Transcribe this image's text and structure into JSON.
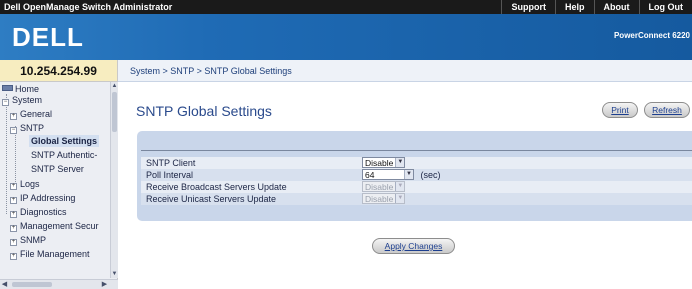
{
  "app": {
    "title": "Dell OpenManage Switch Administrator",
    "top_links": [
      "Support",
      "Help",
      "About",
      "Log Out"
    ]
  },
  "banner": {
    "logo_text": "DELL",
    "product": "PowerConnect 6220"
  },
  "device_ip": "10.254.254.99",
  "breadcrumb": "System > SNTP > SNTP Global Settings",
  "sidebar": {
    "items": [
      {
        "label": "Home",
        "level": 0,
        "icon": "home-icon"
      },
      {
        "label": "System",
        "level": 0,
        "expander": "−"
      },
      {
        "label": "General",
        "level": 1,
        "expander": "+"
      },
      {
        "label": "SNTP",
        "level": 1,
        "expander": "−"
      },
      {
        "label": "Global Settings",
        "level": 2,
        "selected": true
      },
      {
        "label": "SNTP Authentic-",
        "level": 2
      },
      {
        "label": "SNTP Server",
        "level": 2
      },
      {
        "label": "Logs",
        "level": 1,
        "expander": "+"
      },
      {
        "label": "IP Addressing",
        "level": 1,
        "expander": "+"
      },
      {
        "label": "Diagnostics",
        "level": 1,
        "expander": "+"
      },
      {
        "label": "Management Secur",
        "level": 1,
        "expander": "+"
      },
      {
        "label": "SNMP",
        "level": 1,
        "expander": "+"
      },
      {
        "label": "File Management",
        "level": 1,
        "expander": "+"
      }
    ]
  },
  "main": {
    "title": "SNTP Global Settings",
    "print_label": "Print",
    "refresh_label": "Refresh",
    "apply_label": "Apply Changes",
    "fields": {
      "client": {
        "label": "SNTP Client",
        "value": "Disable"
      },
      "poll": {
        "label": "Poll Interval",
        "value": "64",
        "unit": "(sec)"
      },
      "broadcast": {
        "label": "Receive Broadcast Servers Update",
        "value": "Disable",
        "disabled": true
      },
      "unicast": {
        "label": "Receive Unicast Servers Update",
        "value": "Disable",
        "disabled": true
      }
    }
  },
  "icons": {
    "select_arrow": "chevron-down-icon",
    "scroll_up": "arrow-up-icon",
    "scroll_down": "arrow-down-icon",
    "scroll_left": "arrow-left-icon",
    "scroll_right": "arrow-right-icon"
  },
  "colors": {
    "banner": "#1f6bb5",
    "ip_box": "#f7edc0",
    "panel": "#c9d6ea",
    "title": "#2a4a8c"
  }
}
